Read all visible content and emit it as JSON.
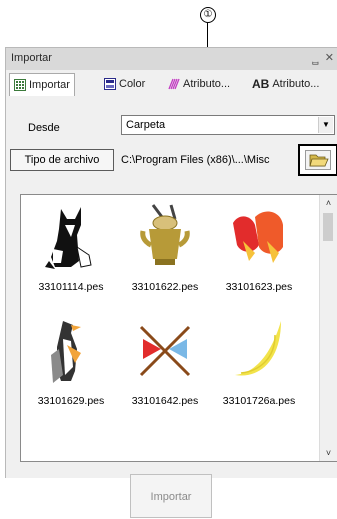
{
  "callout": "①",
  "panel": {
    "title": "Importar",
    "pin_glyph": "ᆸ",
    "close_glyph": "✕",
    "tabs": [
      {
        "label": "Importar",
        "icon": "grid-icon"
      },
      {
        "label": "Color",
        "icon": "color-icon"
      },
      {
        "label": "Atributo...",
        "icon": "stripes-icon"
      },
      {
        "label": "Atributo...",
        "icon": "ab-text-icon",
        "prefix": "AB"
      }
    ]
  },
  "form": {
    "desde_label": "Desde",
    "desde_value": "Carpeta",
    "tipo_button": "Tipo de archivo",
    "path": "C:\\Program Files (x86)\\...\\Misc"
  },
  "gallery": {
    "items": [
      {
        "name": "33101114.pes",
        "icon": "wolf-embroidery-icon"
      },
      {
        "name": "33101622.pes",
        "icon": "pot-embroidery-icon"
      },
      {
        "name": "33101623.pes",
        "icon": "shoes-embroidery-icon"
      },
      {
        "name": "33101629.pes",
        "icon": "penguin-embroidery-icon"
      },
      {
        "name": "33101642.pes",
        "icon": "crossed-flags-embroidery-icon"
      },
      {
        "name": "33101726a.pes",
        "icon": "moon-embroidery-icon"
      }
    ]
  },
  "footer": {
    "import_button": "Importar"
  },
  "colors": {
    "accent_red": "#e22c2c",
    "gold": "#b79a38",
    "disabled_text": "#8b8b8b"
  }
}
